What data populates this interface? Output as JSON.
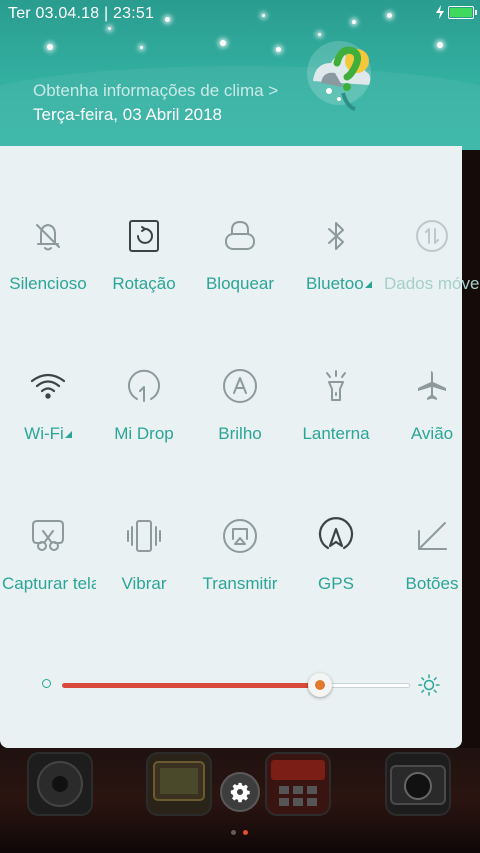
{
  "status_bar": {
    "datetime": "Ter 03.04.18 | 23:51",
    "battery_color": "#3fd95d"
  },
  "header": {
    "weather_link": "Obtenha informações de clima >",
    "date": "Terça-feira, 03 Abril 2018"
  },
  "tiles": [
    {
      "label": "Silencioso",
      "icon": "silent-bell-icon"
    },
    {
      "label": "Rotação",
      "icon": "rotation-lock-icon"
    },
    {
      "label": "Bloquear",
      "icon": "lock-icon"
    },
    {
      "label": "Bluetoo",
      "icon": "bluetooth-icon"
    },
    {
      "label": "Dados móve",
      "icon": "mobile-data-icon"
    },
    {
      "label": "Wi-Fi",
      "icon": "wifi-icon"
    },
    {
      "label": "Mi Drop",
      "icon": "mi-drop-icon"
    },
    {
      "label": "Brilho",
      "icon": "auto-brightness-icon"
    },
    {
      "label": "Lanterna",
      "icon": "flashlight-icon"
    },
    {
      "label": "Avião",
      "icon": "airplane-icon"
    },
    {
      "label": "Capturar tela",
      "icon": "screenshot-icon"
    },
    {
      "label": "Vibrar",
      "icon": "vibrate-icon"
    },
    {
      "label": "Transmitir",
      "icon": "cast-icon"
    },
    {
      "label": "GPS",
      "icon": "gps-icon"
    },
    {
      "label": "Botões",
      "icon": "buttons-icon"
    }
  ],
  "brightness": {
    "level": 0.74,
    "fill_color": "#d84a3a"
  },
  "colors": {
    "accent": "#2ba598",
    "header": "#33b0a1",
    "panel": "#e9f1f2"
  },
  "home": {
    "page_count": 2,
    "active_page": 2
  }
}
